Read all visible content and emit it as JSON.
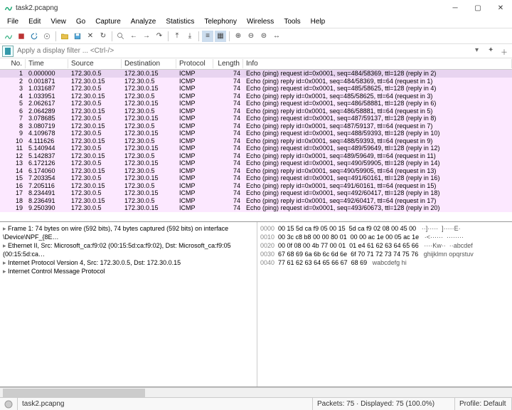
{
  "window": {
    "title": "task2.pcapng"
  },
  "menu": [
    "File",
    "Edit",
    "View",
    "Go",
    "Capture",
    "Analyze",
    "Statistics",
    "Telephony",
    "Wireless",
    "Tools",
    "Help"
  ],
  "filter": {
    "placeholder": "Apply a display filter ... <Ctrl-/>"
  },
  "columns": {
    "no": "No.",
    "time": "Time",
    "src": "Source",
    "dst": "Destination",
    "proto": "Protocol",
    "len": "Length",
    "info": "Info"
  },
  "packets": [
    {
      "no": "1",
      "time": "0.000000",
      "src": "172.30.0.5",
      "dst": "172.30.0.15",
      "proto": "ICMP",
      "len": "74",
      "info": "Echo (ping) request  id=0x0001, seq=484/58369, ttl=128 (reply in 2)"
    },
    {
      "no": "2",
      "time": "0.001871",
      "src": "172.30.0.15",
      "dst": "172.30.0.5",
      "proto": "ICMP",
      "len": "74",
      "info": "Echo (ping) reply    id=0x0001, seq=484/58369, ttl=64 (request in 1)"
    },
    {
      "no": "3",
      "time": "1.031687",
      "src": "172.30.0.5",
      "dst": "172.30.0.15",
      "proto": "ICMP",
      "len": "74",
      "info": "Echo (ping) request  id=0x0001, seq=485/58625, ttl=128 (reply in 4)"
    },
    {
      "no": "4",
      "time": "1.033951",
      "src": "172.30.0.15",
      "dst": "172.30.0.5",
      "proto": "ICMP",
      "len": "74",
      "info": "Echo (ping) reply    id=0x0001, seq=485/58625, ttl=64 (request in 3)"
    },
    {
      "no": "5",
      "time": "2.062617",
      "src": "172.30.0.5",
      "dst": "172.30.0.15",
      "proto": "ICMP",
      "len": "74",
      "info": "Echo (ping) request  id=0x0001, seq=486/58881, ttl=128 (reply in 6)"
    },
    {
      "no": "6",
      "time": "2.064289",
      "src": "172.30.0.15",
      "dst": "172.30.0.5",
      "proto": "ICMP",
      "len": "74",
      "info": "Echo (ping) reply    id=0x0001, seq=486/58881, ttl=64 (request in 5)"
    },
    {
      "no": "7",
      "time": "3.078685",
      "src": "172.30.0.5",
      "dst": "172.30.0.15",
      "proto": "ICMP",
      "len": "74",
      "info": "Echo (ping) request  id=0x0001, seq=487/59137, ttl=128 (reply in 8)"
    },
    {
      "no": "8",
      "time": "3.080719",
      "src": "172.30.0.15",
      "dst": "172.30.0.5",
      "proto": "ICMP",
      "len": "74",
      "info": "Echo (ping) reply    id=0x0001, seq=487/59137, ttl=64 (request in 7)"
    },
    {
      "no": "9",
      "time": "4.109678",
      "src": "172.30.0.5",
      "dst": "172.30.0.15",
      "proto": "ICMP",
      "len": "74",
      "info": "Echo (ping) request  id=0x0001, seq=488/59393, ttl=128 (reply in 10)"
    },
    {
      "no": "10",
      "time": "4.111626",
      "src": "172.30.0.15",
      "dst": "172.30.0.5",
      "proto": "ICMP",
      "len": "74",
      "info": "Echo (ping) reply    id=0x0001, seq=488/59393, ttl=64 (request in 9)"
    },
    {
      "no": "11",
      "time": "5.140944",
      "src": "172.30.0.5",
      "dst": "172.30.0.15",
      "proto": "ICMP",
      "len": "74",
      "info": "Echo (ping) request  id=0x0001, seq=489/59649, ttl=128 (reply in 12)"
    },
    {
      "no": "12",
      "time": "5.142837",
      "src": "172.30.0.15",
      "dst": "172.30.0.5",
      "proto": "ICMP",
      "len": "74",
      "info": "Echo (ping) reply    id=0x0001, seq=489/59649, ttl=64 (request in 11)"
    },
    {
      "no": "13",
      "time": "6.172126",
      "src": "172.30.0.5",
      "dst": "172.30.0.15",
      "proto": "ICMP",
      "len": "74",
      "info": "Echo (ping) request  id=0x0001, seq=490/59905, ttl=128 (reply in 14)"
    },
    {
      "no": "14",
      "time": "6.174060",
      "src": "172.30.0.15",
      "dst": "172.30.0.5",
      "proto": "ICMP",
      "len": "74",
      "info": "Echo (ping) reply    id=0x0001, seq=490/59905, ttl=64 (request in 13)"
    },
    {
      "no": "15",
      "time": "7.203354",
      "src": "172.30.0.5",
      "dst": "172.30.0.15",
      "proto": "ICMP",
      "len": "74",
      "info": "Echo (ping) request  id=0x0001, seq=491/60161, ttl=128 (reply in 16)"
    },
    {
      "no": "16",
      "time": "7.205116",
      "src": "172.30.0.15",
      "dst": "172.30.0.5",
      "proto": "ICMP",
      "len": "74",
      "info": "Echo (ping) reply    id=0x0001, seq=491/60161, ttl=64 (request in 15)"
    },
    {
      "no": "17",
      "time": "8.234491",
      "src": "172.30.0.5",
      "dst": "172.30.0.15",
      "proto": "ICMP",
      "len": "74",
      "info": "Echo (ping) request  id=0x0001, seq=492/60417, ttl=128 (reply in 18)"
    },
    {
      "no": "18",
      "time": "8.236491",
      "src": "172.30.0.15",
      "dst": "172.30.0.5",
      "proto": "ICMP",
      "len": "74",
      "info": "Echo (ping) reply    id=0x0001, seq=492/60417, ttl=64 (request in 17)"
    },
    {
      "no": "19",
      "time": "9.250390",
      "src": "172.30.0.5",
      "dst": "172.30.0.15",
      "proto": "ICMP",
      "len": "74",
      "info": "Echo (ping) request  id=0x0001, seq=493/60673, ttl=128 (reply in 20)"
    }
  ],
  "tree": [
    "Frame 1: 74 bytes on wire (592 bits), 74 bytes captured (592 bits) on interface \\Device\\NPF_{8E…",
    "Ethernet II, Src: Microsoft_ca:f9:02 (00:15:5d:ca:f9:02), Dst: Microsoft_ca:f9:05 (00:15:5d:ca…",
    "Internet Protocol Version 4, Src: 172.30.0.5, Dst: 172.30.0.15",
    "Internet Control Message Protocol"
  ],
  "hex": [
    {
      "off": "0000",
      "b": "00 15 5d ca f9 05 00 15  5d ca f9 02 08 00 45 00",
      "a": "··]·····  ]·····E·"
    },
    {
      "off": "0010",
      "b": "00 3c c8 b8 00 00 80 01  00 00 ac 1e 00 05 ac 1e",
      "a": "·<······  ········"
    },
    {
      "off": "0020",
      "b": "00 0f 08 00 4b 77 00 01  01 e4 61 62 63 64 65 66",
      "a": "····Kw··  ··abcdef"
    },
    {
      "off": "0030",
      "b": "67 68 69 6a 6b 6c 6d 6e  6f 70 71 72 73 74 75 76",
      "a": "ghijklmn opqrstuv"
    },
    {
      "off": "0040",
      "b": "77 61 62 63 64 65 66 67  68 69",
      "a": "wabcdefg hi"
    }
  ],
  "status": {
    "file": "task2.pcapng",
    "mid": "Packets: 75 · Displayed: 75 (100.0%)",
    "profile": "Profile: Default"
  }
}
